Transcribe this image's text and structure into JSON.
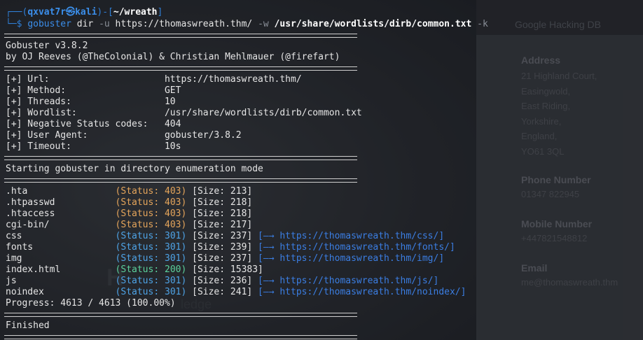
{
  "background": {
    "ghdb_label": "Google Hacking DB",
    "big_heading": "H",
    "ledge_text": "ledge",
    "address_heading": "Address",
    "address_lines": "21 Highland Court,\nEasingwold,\nEast Riding,\nYorkshire,\nEngland,\nYO61 3QL",
    "phone_heading": "Phone Number",
    "phone_value": "01347 822945",
    "mobile_heading": "Mobile Number",
    "mobile_value": "+447821548812",
    "email_heading": "Email",
    "email_value": "me@thomaswreath.thm"
  },
  "prompt": {
    "frame_top": "┌──(",
    "user_host": "qxvat7r㉿kali",
    "mid": ")-[",
    "path": "~/wreath",
    "end": "]",
    "frame_bottom": "└─$ ",
    "cmd": "gobuster",
    "arg1": " dir ",
    "flag_u": "-u",
    "url": " https://thomaswreath.thm/ ",
    "flag_w": "-w",
    "wordlist": " /usr/share/wordlists/dirb/common.txt ",
    "flag_k": "-k"
  },
  "banner": {
    "version": "Gobuster v3.8.2",
    "authors": "by OJ Reeves (@TheColonial) & Christian Mehlmauer (@firefart)"
  },
  "config": [
    {
      "key": "[+] Url:                     ",
      "value": "https://thomaswreath.thm/"
    },
    {
      "key": "[+] Method:                  ",
      "value": "GET"
    },
    {
      "key": "[+] Threads:                 ",
      "value": "10"
    },
    {
      "key": "[+] Wordlist:                ",
      "value": "/usr/share/wordlists/dirb/common.txt"
    },
    {
      "key": "[+] Negative Status codes:   ",
      "value": "404"
    },
    {
      "key": "[+] User Agent:              ",
      "value": "gobuster/3.8.2"
    },
    {
      "key": "[+] Timeout:                 ",
      "value": "10s"
    }
  ],
  "start_msg": "Starting gobuster in directory enumeration mode",
  "results": [
    {
      "path": ".hta                ",
      "status": "(Status: 403)",
      "cls": "s403",
      "size": " [Size: 213]",
      "redirect": ""
    },
    {
      "path": ".htpasswd           ",
      "status": "(Status: 403)",
      "cls": "s403",
      "size": " [Size: 218]",
      "redirect": ""
    },
    {
      "path": ".htaccess           ",
      "status": "(Status: 403)",
      "cls": "s403",
      "size": " [Size: 218]",
      "redirect": ""
    },
    {
      "path": "cgi-bin/            ",
      "status": "(Status: 403)",
      "cls": "s403",
      "size": " [Size: 217]",
      "redirect": ""
    },
    {
      "path": "css                 ",
      "status": "(Status: 301)",
      "cls": "s301",
      "size": " [Size: 237] ",
      "redirect": "[—→ https://thomaswreath.thm/css/]"
    },
    {
      "path": "fonts               ",
      "status": "(Status: 301)",
      "cls": "s301",
      "size": " [Size: 239] ",
      "redirect": "[—→ https://thomaswreath.thm/fonts/]"
    },
    {
      "path": "img                 ",
      "status": "(Status: 301)",
      "cls": "s301",
      "size": " [Size: 237] ",
      "redirect": "[—→ https://thomaswreath.thm/img/]"
    },
    {
      "path": "index.html          ",
      "status": "(Status: 200)",
      "cls": "s200",
      "size": " [Size: 15383]",
      "redirect": ""
    },
    {
      "path": "js                  ",
      "status": "(Status: 301)",
      "cls": "s301",
      "size": " [Size: 236] ",
      "redirect": "[—→ https://thomaswreath.thm/js/]"
    },
    {
      "path": "noindex             ",
      "status": "(Status: 301)",
      "cls": "s301",
      "size": " [Size: 241] ",
      "redirect": "[—→ https://thomaswreath.thm/noindex/]"
    }
  ],
  "progress": "Progress: 4613 / 4613 (100.00%)",
  "finished": "Finished"
}
